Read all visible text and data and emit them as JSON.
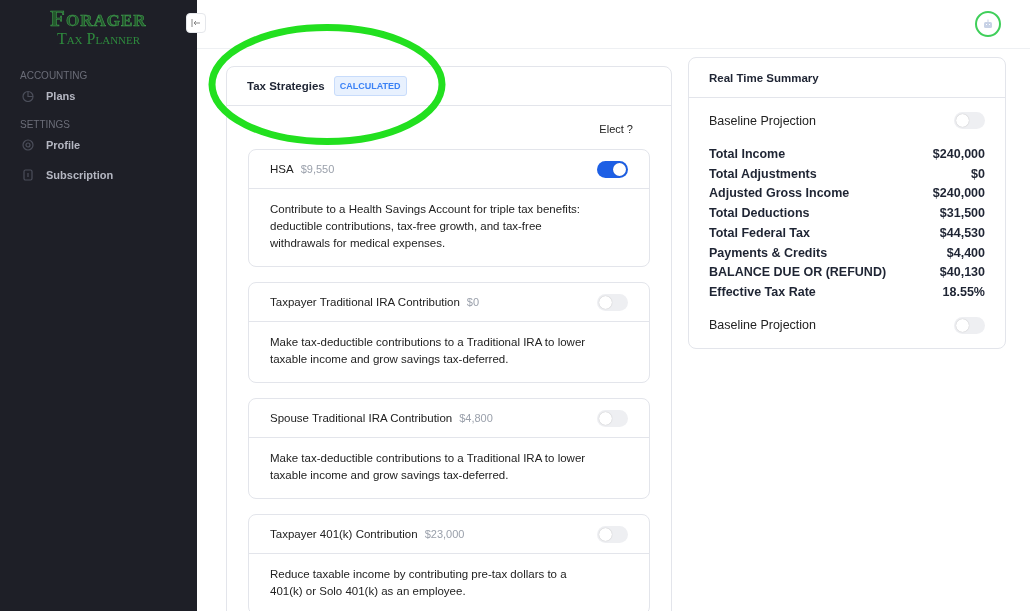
{
  "sidebar": {
    "logo": {
      "title": "Forager",
      "subtitle": "Tax Planner"
    },
    "sections": [
      {
        "heading": "ACCOUNTING",
        "items": [
          {
            "label": "Plans",
            "kind": "plans"
          }
        ]
      },
      {
        "heading": "SETTINGS",
        "items": [
          {
            "label": "Profile",
            "kind": "profile"
          },
          {
            "label": "Subscription",
            "kind": "subscription"
          }
        ]
      }
    ]
  },
  "strategies": {
    "title": "Tax Strategies",
    "badge": "CALCULATED",
    "elect_label": "Elect ?",
    "items": [
      {
        "name": "HSA",
        "amount": "$9,550",
        "on": true,
        "description": "Contribute to a Health Savings Account for triple tax benefits: deductible contributions, tax-free growth, and tax-free withdrawals for medical expenses."
      },
      {
        "name": "Taxpayer Traditional IRA Contribution",
        "amount": "$0",
        "on": false,
        "description": "Make tax-deductible contributions to a Traditional IRA to lower taxable income and grow savings tax-deferred."
      },
      {
        "name": "Spouse Traditional IRA Contribution",
        "amount": "$4,800",
        "on": false,
        "description": "Make tax-deductible contributions to a Traditional IRA to lower taxable income and grow savings tax-deferred."
      },
      {
        "name": "Taxpayer 401(k) Contribution",
        "amount": "$23,000",
        "on": false,
        "description": "Reduce taxable income by contributing pre-tax dollars to a 401(k) or Solo 401(k) as an employee."
      }
    ]
  },
  "summary": {
    "title": "Real Time Summary",
    "top_toggle": {
      "label": "Baseline Projection",
      "on": false
    },
    "rows": [
      {
        "label": "Total Income",
        "value": "$240,000"
      },
      {
        "label": "Total Adjustments",
        "value": "$0"
      },
      {
        "label": "Adjusted Gross Income",
        "value": "$240,000"
      },
      {
        "label": "Total Deductions",
        "value": "$31,500"
      },
      {
        "label": "Total Federal Tax",
        "value": "$44,530"
      },
      {
        "label": "Payments & Credits",
        "value": "$4,400"
      },
      {
        "label": "BALANCE DUE OR (REFUND)",
        "value": "$40,130"
      },
      {
        "label": "Effective Tax Rate",
        "value": "18.55%"
      }
    ],
    "bottom_toggle": {
      "label": "Baseline Projection",
      "on": false
    }
  }
}
